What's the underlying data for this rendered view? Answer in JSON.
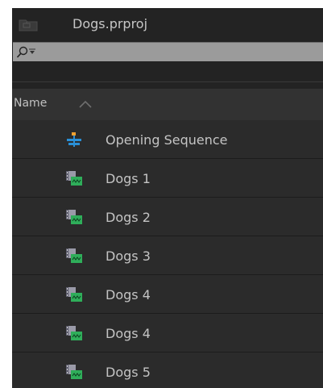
{
  "project": {
    "title": "Dogs.prproj",
    "folder_icon": "folder-icon"
  },
  "search": {
    "value": "",
    "placeholder": "",
    "icon": "magnifier-icon"
  },
  "columns": {
    "name_label": "Name",
    "sort_icon": "sort-ascending-icon"
  },
  "items": [
    {
      "label": "Opening Sequence",
      "icon": "sequence-icon"
    },
    {
      "label": "Dogs 1",
      "icon": "clip-icon"
    },
    {
      "label": "Dogs 2",
      "icon": "clip-icon"
    },
    {
      "label": "Dogs 3",
      "icon": "clip-icon"
    },
    {
      "label": "Dogs 4",
      "icon": "clip-icon"
    },
    {
      "label": "Dogs 4",
      "icon": "clip-icon"
    },
    {
      "label": "Dogs 5",
      "icon": "clip-icon"
    }
  ],
  "colors": {
    "panel_bg": "#232323",
    "row_bg": "#2b2b2b",
    "search_bg": "#9b9b9b",
    "text": "#c4c4c4",
    "clip_green": "#2fae5a",
    "sequence_blue": "#2a8fd6",
    "sequence_orange": "#f0a030"
  }
}
